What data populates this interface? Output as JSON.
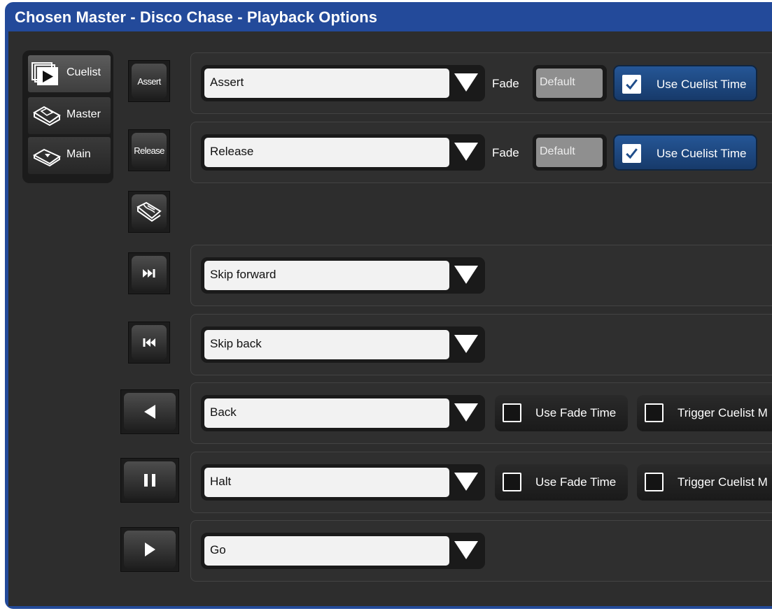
{
  "window": {
    "title": "Chosen Master - Disco Chase - Playback Options"
  },
  "sidebar": {
    "items": [
      {
        "label": "Cuelist",
        "icon": "cuelist-icon",
        "selected": true
      },
      {
        "label": "Master",
        "icon": "master-icon",
        "selected": false
      },
      {
        "label": "Main",
        "icon": "main-icon",
        "selected": false
      }
    ]
  },
  "rows": {
    "assert": {
      "button_label": "Assert",
      "dropdown_value": "Assert",
      "fade_label": "Fade",
      "fade_placeholder": "Default",
      "use_cuelist_time_label": "Use Cuelist Time",
      "use_cuelist_time_checked": true
    },
    "release": {
      "button_label": "Release",
      "dropdown_value": "Release",
      "fade_label": "Fade",
      "fade_placeholder": "Default",
      "use_cuelist_time_label": "Use Cuelist Time",
      "use_cuelist_time_checked": true
    },
    "hand": {
      "icon": "hand-icon"
    },
    "skip_forward": {
      "icon": "skip-forward-icon",
      "dropdown_value": "Skip forward"
    },
    "skip_back": {
      "icon": "skip-back-icon",
      "dropdown_value": "Skip back"
    },
    "back": {
      "icon": "back-icon",
      "dropdown_value": "Back",
      "use_fade_time_label": "Use Fade Time",
      "use_fade_time_checked": false,
      "trigger_label": "Trigger Cuelist M",
      "trigger_checked": false
    },
    "halt": {
      "icon": "pause-icon",
      "dropdown_value": "Halt",
      "use_fade_time_label": "Use Fade Time",
      "use_fade_time_checked": false,
      "trigger_label": "Trigger Cuelist M",
      "trigger_checked": false
    },
    "go": {
      "icon": "play-icon",
      "dropdown_value": "Go"
    }
  },
  "colors": {
    "title_bar": "#234a9a",
    "panel_bg": "#2d2d2d",
    "checked_toggle": "#1f4d8a"
  }
}
